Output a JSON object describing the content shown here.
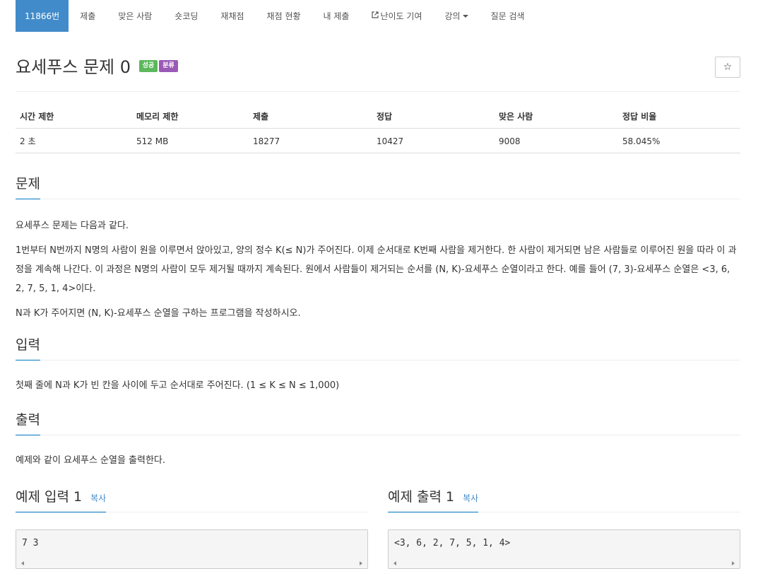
{
  "nav": {
    "items": [
      {
        "label": "11866번"
      },
      {
        "label": "제출"
      },
      {
        "label": "맞은 사람"
      },
      {
        "label": "숏코딩"
      },
      {
        "label": "재채점"
      },
      {
        "label": "채점 현황"
      },
      {
        "label": "내 제출"
      },
      {
        "label": "난이도 기여"
      },
      {
        "label": "강의"
      },
      {
        "label": "질문 검색"
      }
    ]
  },
  "problem": {
    "title": "요세푸스 문제 0",
    "badges": [
      "성공",
      "분류"
    ],
    "star": "☆"
  },
  "info": {
    "headers": [
      "시간 제한",
      "메모리 제한",
      "제출",
      "정답",
      "맞은 사람",
      "정답 비율"
    ],
    "values": [
      "2 초",
      "512 MB",
      "18277",
      "10427",
      "9008",
      "58.045%"
    ]
  },
  "sections": {
    "description": {
      "heading": "문제",
      "paragraphs": [
        "요세푸스 문제는 다음과 같다.",
        "1번부터 N번까지 N명의 사람이 원을 이루면서 앉아있고, 양의 정수 K(≤ N)가 주어진다. 이제 순서대로 K번째 사람을 제거한다. 한 사람이 제거되면 남은 사람들로 이루어진 원을 따라 이 과정을 계속해 나간다. 이 과정은 N명의 사람이 모두 제거될 때까지 계속된다. 원에서 사람들이 제거되는 순서를 (N, K)-요세푸스 순열이라고 한다. 예를 들어 (7, 3)-요세푸스 순열은 <3, 6, 2, 7, 5, 1, 4>이다.",
        "N과 K가 주어지면 (N, K)-요세푸스 순열을 구하는 프로그램을 작성하시오."
      ]
    },
    "input": {
      "heading": "입력",
      "text": "첫째 줄에 N과 K가 빈 칸을 사이에 두고 순서대로 주어진다. (1 ≤ K ≤ N ≤ 1,000)"
    },
    "output": {
      "heading": "출력",
      "text": "예제와 같이 요세푸스 순열을 출력한다."
    }
  },
  "samples": {
    "input": {
      "heading": "예제 입력 1",
      "copy": "복사",
      "content": "7 3"
    },
    "output": {
      "heading": "예제 출력 1",
      "copy": "복사",
      "content": "<3, 6, 2, 7, 5, 1, 4>"
    }
  },
  "colors": {
    "nav_active": "#428bca",
    "badge_success": "#5cb85c",
    "badge_category": "#9b59b6",
    "link": "#428bca"
  }
}
